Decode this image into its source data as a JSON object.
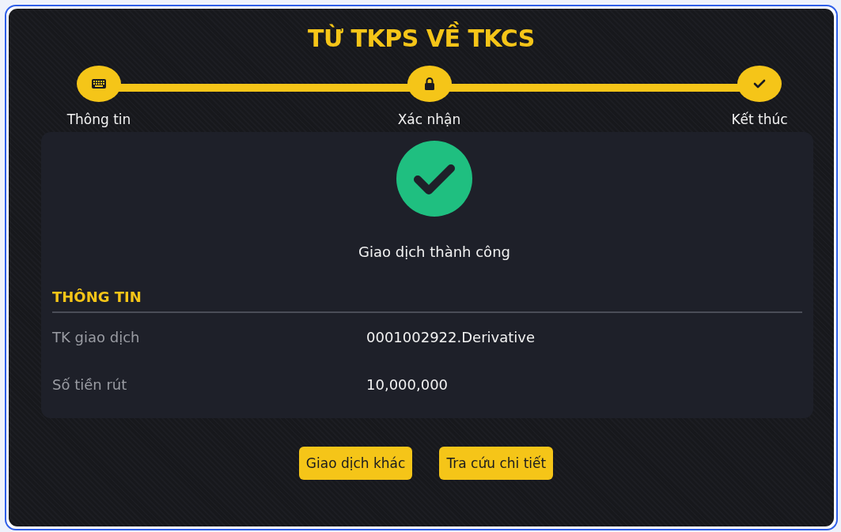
{
  "title": "TỪ TKPS VỀ TKCS",
  "steps": [
    {
      "label": "Thông tin",
      "kind": "keyboard"
    },
    {
      "label": "Xác nhận",
      "kind": "lock"
    },
    {
      "label": "Kết thúc",
      "kind": "check"
    }
  ],
  "result": {
    "message": "Giao dịch thành công"
  },
  "info": {
    "heading": "THÔNG TIN",
    "rows": [
      {
        "label": "TK giao dịch",
        "value": "0001002922.Derivative"
      },
      {
        "label": "Số tiền rút",
        "value": "10,000,000"
      }
    ]
  },
  "buttons": [
    "Giao dịch khác",
    "Tra cứu chi tiết"
  ]
}
